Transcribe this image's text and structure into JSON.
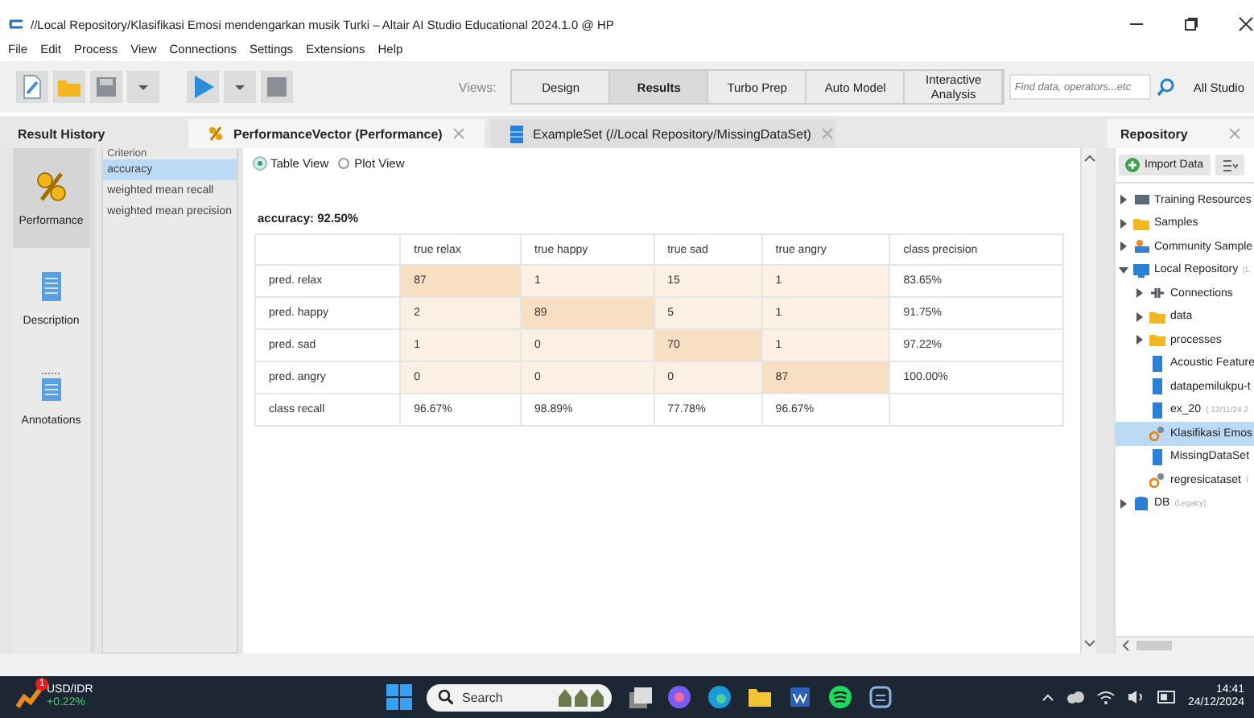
{
  "window": {
    "title": "//Local Repository/Klasifikasi Emosi mendengarkan musik Turki  – Altair AI Studio Educational 2024.1.0 @ HP"
  },
  "menu": [
    "File",
    "Edit",
    "Process",
    "View",
    "Connections",
    "Settings",
    "Extensions",
    "Help"
  ],
  "toolbar": {
    "views_label": "Views:",
    "views": [
      {
        "label": "Design",
        "selected": false
      },
      {
        "label": "Results",
        "selected": true
      },
      {
        "label": "Turbo Prep",
        "selected": false
      },
      {
        "label": "Auto Model",
        "selected": false
      },
      {
        "label": "Interactive Analysis",
        "selected": false
      }
    ],
    "search": {
      "placeholder": "Find data, operators...etc"
    },
    "scope": "All Studio"
  },
  "tabs": [
    {
      "label": "Result History",
      "kind": "plain",
      "selected": false
    },
    {
      "label": "PerformanceVector (Performance)",
      "kind": "performance",
      "selected": true
    },
    {
      "label": "ExampleSet (//Local Repository/MissingDataSet)",
      "kind": "data",
      "selected": false
    }
  ],
  "side_tabs": [
    {
      "label": "Performance",
      "kind": "percent",
      "selected": true
    },
    {
      "label": "Description",
      "kind": "doc",
      "selected": false
    },
    {
      "label": "Annotations",
      "kind": "note",
      "selected": false
    }
  ],
  "criterion": {
    "label": "Criterion",
    "items": [
      {
        "label": "accuracy",
        "selected": true
      },
      {
        "label": "weighted mean recall",
        "selected": false
      },
      {
        "label": "weighted mean precision",
        "selected": false
      }
    ]
  },
  "view_options": [
    {
      "label": "Table View",
      "selected": true
    },
    {
      "label": "Plot View",
      "selected": false
    }
  ],
  "result": {
    "title": "accuracy: 92.50%",
    "columns": [
      "true relax",
      "true happy",
      "true sad",
      "true angry",
      "class precision"
    ],
    "rows": [
      {
        "label": "pred. relax",
        "cells": [
          {
            "text": "87",
            "kind": "diagonal"
          },
          {
            "text": "1",
            "kind": "count"
          },
          {
            "text": "15",
            "kind": "count"
          },
          {
            "text": "1",
            "kind": "count"
          },
          {
            "text": "83.65%",
            "kind": "rate"
          }
        ]
      },
      {
        "label": "pred. happy",
        "cells": [
          {
            "text": "2",
            "kind": "count"
          },
          {
            "text": "89",
            "kind": "diagonal"
          },
          {
            "text": "5",
            "kind": "count"
          },
          {
            "text": "1",
            "kind": "count"
          },
          {
            "text": "91.75%",
            "kind": "rate"
          }
        ]
      },
      {
        "label": "pred. sad",
        "cells": [
          {
            "text": "1",
            "kind": "count"
          },
          {
            "text": "0",
            "kind": "count"
          },
          {
            "text": "70",
            "kind": "diagonal"
          },
          {
            "text": "1",
            "kind": "count"
          },
          {
            "text": "97.22%",
            "kind": "rate"
          }
        ]
      },
      {
        "label": "pred. angry",
        "cells": [
          {
            "text": "0",
            "kind": "count"
          },
          {
            "text": "0",
            "kind": "count"
          },
          {
            "text": "0",
            "kind": "count"
          },
          {
            "text": "87",
            "kind": "diagonal"
          },
          {
            "text": "100.00%",
            "kind": "rate"
          }
        ]
      },
      {
        "label": "class recall",
        "cells": [
          {
            "text": "96.67%",
            "kind": "rate"
          },
          {
            "text": "98.89%",
            "kind": "rate"
          },
          {
            "text": "77.78%",
            "kind": "rate"
          },
          {
            "text": "96.67%",
            "kind": "rate"
          }
        ]
      }
    ]
  },
  "repository": {
    "title": "Repository",
    "import_button": "Import Data",
    "tree": [
      {
        "label": "Training Resources",
        "kind": "training",
        "expanded": false
      },
      {
        "label": "Samples",
        "kind": "folder",
        "expanded": false
      },
      {
        "label": "Community Sample",
        "kind": "community",
        "expanded": false
      },
      {
        "label": "Local Repository",
        "note": "(L",
        "kind": "repo",
        "expanded": true,
        "children": [
          {
            "label": "Connections",
            "kind": "connections",
            "expanded": false
          },
          {
            "label": "data",
            "kind": "folder",
            "expanded": false
          },
          {
            "label": "processes",
            "kind": "folder",
            "expanded": false
          },
          {
            "label": "Acoustic Feature",
            "kind": "dataset"
          },
          {
            "label": "datapemilukpu-t",
            "kind": "dataset"
          },
          {
            "label": "ex_20",
            "note": "( 12/11/24 2",
            "kind": "dataset"
          },
          {
            "label": "Klasifikasi Emos",
            "kind": "process",
            "selected": true
          },
          {
            "label": "MissingDataSet",
            "kind": "dataset"
          },
          {
            "label": "regresicataset",
            "note": "(",
            "kind": "process"
          }
        ]
      },
      {
        "label": "DB",
        "note": "(Legacy)",
        "kind": "db",
        "expanded": false
      }
    ]
  },
  "taskbar": {
    "ticker": {
      "name": "USD/IDR",
      "change": "+0.22%",
      "badge": "1"
    },
    "search": {
      "placeholder": "Search"
    },
    "time": "14:41",
    "date": "24/12/2024"
  }
}
